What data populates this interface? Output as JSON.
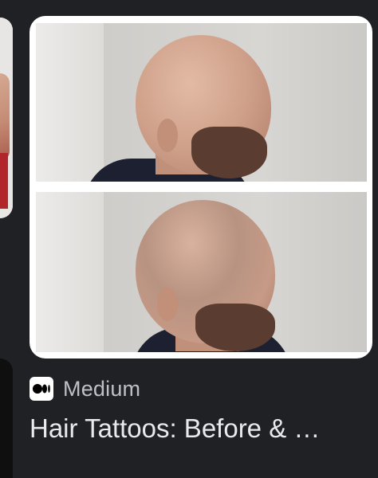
{
  "result": {
    "source": {
      "name": "Medium",
      "icon": "medium-logo-icon"
    },
    "title": "Hair Tattoos: Before & …",
    "image": {
      "panels": [
        "before-photo",
        "after-photo"
      ]
    }
  },
  "colors": {
    "background": "#202124",
    "card": "#ffffff",
    "source_text": "#bdc1c6",
    "title_text": "#e8eaed"
  }
}
